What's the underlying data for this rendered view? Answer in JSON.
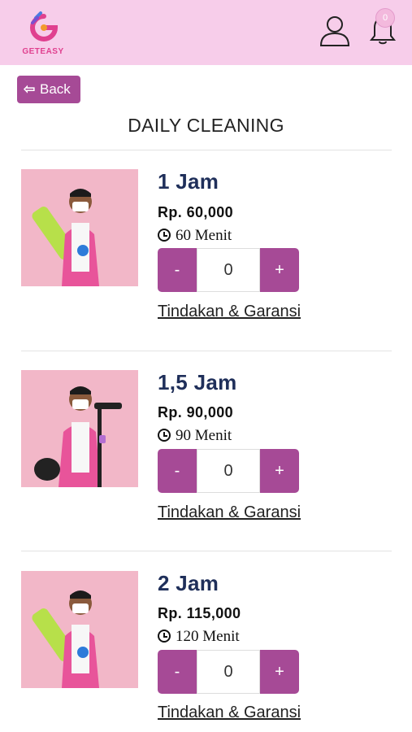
{
  "header": {
    "logo_text": "GETEASY",
    "notification_count": "0"
  },
  "back_label": "Back",
  "page_title": "DAILY CLEANING",
  "packages": [
    {
      "duration": "1 Jam",
      "price": "Rp. 60,000",
      "minutes": "60 Menit",
      "quantity": "0",
      "minus": "-",
      "plus": "+",
      "terms": "Tindakan & Garansi"
    },
    {
      "duration": "1,5 Jam",
      "price": "Rp. 90,000",
      "minutes": "90 Menit",
      "quantity": "0",
      "minus": "-",
      "plus": "+",
      "terms": "Tindakan & Garansi"
    },
    {
      "duration": "2 Jam",
      "price": "Rp. 115,000",
      "minutes": "120 Menit",
      "quantity": "0",
      "minus": "-",
      "plus": "+",
      "terms": "Tindakan & Garansi"
    }
  ],
  "colors": {
    "header_bg": "#f7cdea",
    "accent": "#a64a96",
    "title_navy": "#1f2f5a",
    "photo_bg": "#f2b7c8"
  },
  "icons": [
    "geteasy-logo-icon",
    "user-icon",
    "bell-icon",
    "back-arrow-icon",
    "clock-icon"
  ]
}
